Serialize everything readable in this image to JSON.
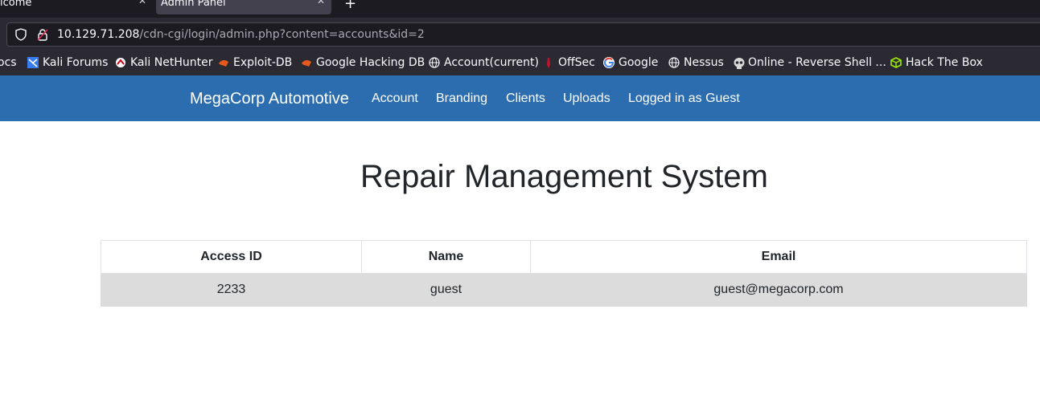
{
  "browser": {
    "tabs": [
      {
        "title": "lcome",
        "active": false
      },
      {
        "title": "Admin Panel",
        "active": true
      }
    ],
    "new_tab": "+",
    "close_glyph": "✕",
    "url": {
      "host": "10.129.71.208",
      "path": "/cdn-cgi/login/admin.php?content=accounts&id=2"
    },
    "bookmarks": [
      {
        "label": "ocs",
        "icon": "none"
      },
      {
        "label": "Kali Forums",
        "icon": "kali-icon"
      },
      {
        "label": "Kali NetHunter",
        "icon": "nethunter-icon"
      },
      {
        "label": "Exploit-DB",
        "icon": "exploit-db-icon"
      },
      {
        "label": "Google Hacking DB",
        "icon": "exploit-db-icon"
      },
      {
        "label": "Account(current)",
        "icon": "globe-icon"
      },
      {
        "label": "OffSec",
        "icon": "offsec-icon"
      },
      {
        "label": "Google",
        "icon": "google-icon"
      },
      {
        "label": "Nessus",
        "icon": "globe-icon"
      },
      {
        "label": "Online - Reverse Shell ...",
        "icon": "skull-icon"
      },
      {
        "label": "Hack The Box",
        "icon": "htb-icon"
      }
    ]
  },
  "app": {
    "brand": "MegaCorp Automotive",
    "nav": [
      "Account",
      "Branding",
      "Clients",
      "Uploads",
      "Logged in as Guest"
    ],
    "nav_color": "#2c6db0"
  },
  "main": {
    "title": "Repair Management System",
    "table": {
      "headers": [
        "Access ID",
        "Name",
        "Email"
      ],
      "rows": [
        [
          "2233",
          "guest",
          "guest@megacorp.com"
        ]
      ]
    }
  }
}
